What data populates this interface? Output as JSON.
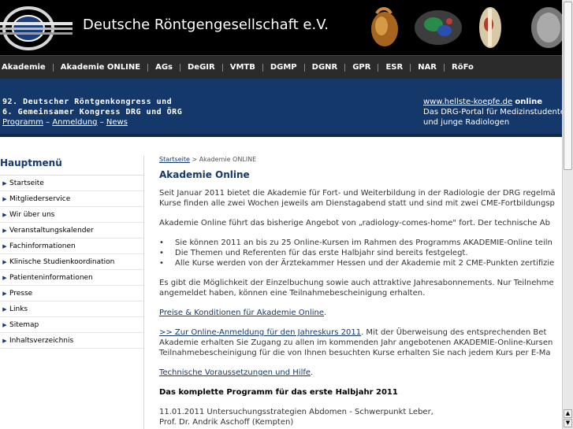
{
  "header": {
    "title": "Deutsche Röntgengesellschaft e.V."
  },
  "nav": {
    "items": [
      "Akademie",
      "Akademie ONLINE",
      "AGs",
      "DeGIR",
      "VMTB",
      "DGMP",
      "DGNR",
      "GPR",
      "ESR",
      "NAR",
      "RöFo"
    ]
  },
  "banner": {
    "line1": "92. Deutscher Röntgenkongress und",
    "line2": "6. Gemeinsamer Kongress DRG und ÖRG",
    "link_program": "Programm",
    "link_registration": "Anmeldung",
    "link_news": "News",
    "dash": "–",
    "right_link": "www.hellste-koepfe.de",
    "right_online": "online",
    "right_line2": "Das DRG-Portal für Medizinstudenten",
    "right_line3": "und junge Radiologen"
  },
  "sidebar": {
    "title": "Hauptmenü",
    "items": [
      "Startseite",
      "Mitgliederservice",
      "Wir über uns",
      "Veranstaltungskalender",
      "Fachinformationen",
      "Klinische Studienkoordination",
      "Patienteninformationen",
      "Presse",
      "Links",
      "Sitemap",
      "Inhaltsverzeichnis"
    ]
  },
  "content": {
    "breadcrumb_home": "Startseite",
    "breadcrumb_rest": " > Akademie ONLINE",
    "title": "Akademie Online",
    "p1_line1": "Seit Januar 2011 bietet die Akademie für Fort- und Weiterbildung in der Radiologie der DRG regelmä",
    "p1_line2": "Kurse finden alle zwei Wochen jeweils am Dienstagabend statt und sind mit zwei CME-Fortbildungsp",
    "p2": "Akademie Online führt das bisherige Angebot von „radiology-comes-home\" fort. Der technische Ab",
    "bullets": [
      "Sie können 2011 an bis zu 25 Online-Kursen im Rahmen des Programms AKADEMIE-Online teiln",
      "Die Themen und Referenten für das erste Halbjahr sind bereits festgelegt.",
      "Alle Kurse werden von der Ärztekammer Hessen und der Akademie mit 2 CME-Punkten zertifizie"
    ],
    "bullet_char": "•",
    "p3_line1": "Es gibt die Möglichkeit der Einzelbuchung sowie auch attraktive Jahresabonnements. Nur Teilnehme",
    "p3_line2": "angemeldet haben, können eine Teilnahmebescheinigung erhalten.",
    "link_prices": "Preise & Konditionen für Akademie Online",
    "link_prices_after": ".",
    "link_registration": ">> Zur Online-Anmeldung für den Jahreskurs 2011",
    "p4_line1_after": ". Mit der Überweisung des entsprechenden Bet",
    "p4_line2": "Akademie erhalten Sie Zugang zu allen im kommenden Jahr angebotenen AKADEMIE-Online-Kursen",
    "p4_line3": "Teilnahmebescheinigung für die von Ihnen besuchten Kurse erhalten Sie nach jedem Kurs per E-Ma",
    "link_tech": "Technische Voraussetzungen und Hilfe",
    "link_tech_after": ".",
    "program_heading": "Das komplette Programm für das erste Halbjahr 2011",
    "program_line1": "11.01.2011 Untersuchungsstrategien Abdomen - Schwerpunkt Leber,",
    "program_line2": "Prof. Dr. Andrik Aschoff (Kempten)"
  },
  "scrollbar": {
    "up": "▲",
    "down": "▼"
  },
  "colors": {
    "header_bg": "#000000",
    "nav_bg": "#2b2b2b",
    "banner_bg": "#15386b",
    "accent": "#15386b"
  }
}
